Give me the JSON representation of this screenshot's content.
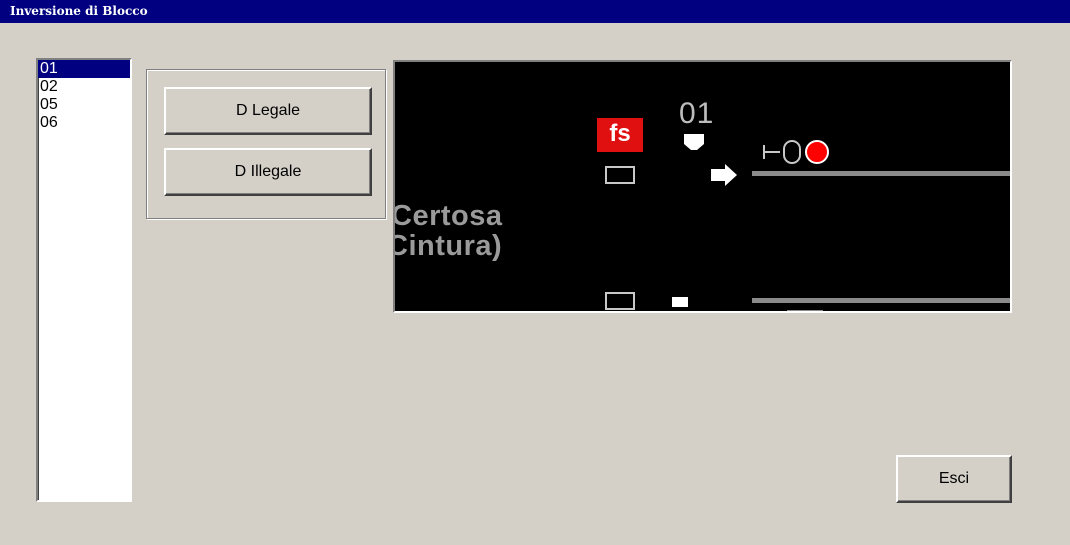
{
  "window": {
    "title": "Inversione di Blocco"
  },
  "block_list": {
    "items": [
      "01",
      "02",
      "05",
      "06"
    ],
    "selected": "01"
  },
  "actions": {
    "legale_label": "D Legale",
    "illegale_label": "D Illegale",
    "exit_label": "Esci"
  },
  "schema": {
    "badge": "fs",
    "track_number": "01",
    "station_line1": "Certosa",
    "station_line2": "Cintura)",
    "signal_color": "#ff0000",
    "badge_color": "#e01010",
    "track_color": "#8a8a8a"
  }
}
